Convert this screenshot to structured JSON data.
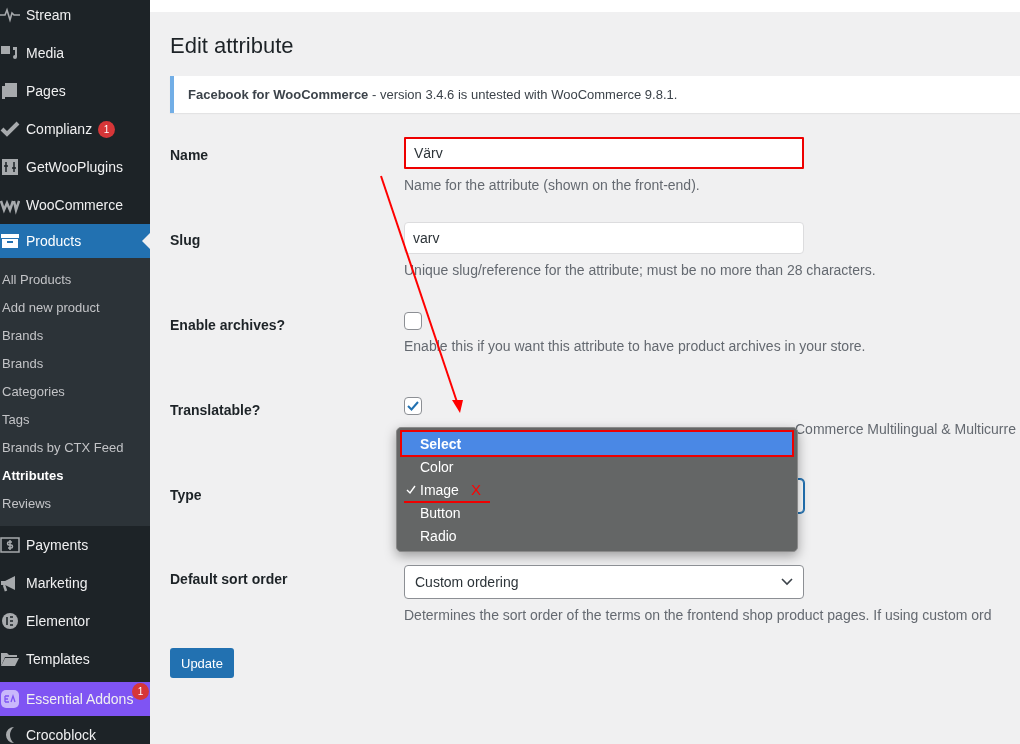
{
  "sidebar": {
    "items": [
      {
        "label": "Stream",
        "current": false,
        "highlighted": false
      },
      {
        "label": "Media",
        "current": false,
        "highlighted": false
      },
      {
        "label": "Pages",
        "current": false,
        "highlighted": false
      },
      {
        "label": "Complianz",
        "current": false,
        "highlighted": false,
        "badge": "1"
      },
      {
        "label": "GetWooPlugins",
        "current": false,
        "highlighted": false
      },
      {
        "label": "WooCommerce",
        "current": false,
        "highlighted": false
      },
      {
        "label": "Products",
        "current": true,
        "highlighted": false,
        "submenu": [
          {
            "label": "All Products",
            "selected": false
          },
          {
            "label": "Add new product",
            "selected": false
          },
          {
            "label": "Brands",
            "selected": false
          },
          {
            "label": "Brands",
            "selected": false
          },
          {
            "label": "Categories",
            "selected": false
          },
          {
            "label": "Tags",
            "selected": false
          },
          {
            "label": "Brands by CTX Feed",
            "selected": false
          },
          {
            "label": "Attributes",
            "selected": true
          },
          {
            "label": "Reviews",
            "selected": false
          }
        ]
      },
      {
        "label": "Payments",
        "current": false,
        "highlighted": false
      },
      {
        "label": "Marketing",
        "current": false,
        "highlighted": false
      },
      {
        "label": "Elementor",
        "current": false,
        "highlighted": false
      },
      {
        "label": "Templates",
        "current": false,
        "highlighted": false
      },
      {
        "label": "Essential Addons",
        "current": false,
        "highlighted": true,
        "badge": "1"
      },
      {
        "label": "Crocoblock",
        "current": false,
        "highlighted": false
      }
    ]
  },
  "page": {
    "title": "Edit attribute",
    "notice": {
      "text": "**Facebook for WooCommerce** - version 3.4.6 is untested with WooCommerce 9.8.1."
    },
    "fields": [
      {
        "kind": "text",
        "label": "Name",
        "value": "Värv",
        "description": "Name for the attribute (shown on the front-end).",
        "highlighted": true
      },
      {
        "kind": "text",
        "label": "Slug",
        "value": "varv",
        "description": "Unique slug/reference for the attribute; must be no more than 28 characters.",
        "highlighted": false
      },
      {
        "kind": "checkbox",
        "label": "Enable archives?",
        "checked": false,
        "description": "Enable this if you want this attribute to have product archives in your store."
      },
      {
        "kind": "checkbox",
        "label": "Translatable?",
        "checked": true,
        "description": "Commerce Multilingual & Multicurre"
      },
      {
        "kind": "dropdown",
        "label": "Type",
        "focused": true,
        "options": [
          {
            "label": "Select",
            "selected": true,
            "checked": false,
            "highlighted": true
          },
          {
            "label": "Color",
            "selected": false,
            "checked": false,
            "highlighted": false
          },
          {
            "label": "Image",
            "selected": false,
            "checked": true,
            "highlighted": false,
            "mark": "X"
          },
          {
            "label": "Button",
            "selected": false,
            "checked": false,
            "highlighted": false
          },
          {
            "label": "Radio",
            "selected": false,
            "checked": false,
            "highlighted": false
          }
        ]
      },
      {
        "kind": "select",
        "label": "Default sort order",
        "value": "Custom ordering",
        "description": "Determines the sort order of the terms on the frontend shop product pages. If using custom ord"
      }
    ],
    "button": "Update"
  }
}
